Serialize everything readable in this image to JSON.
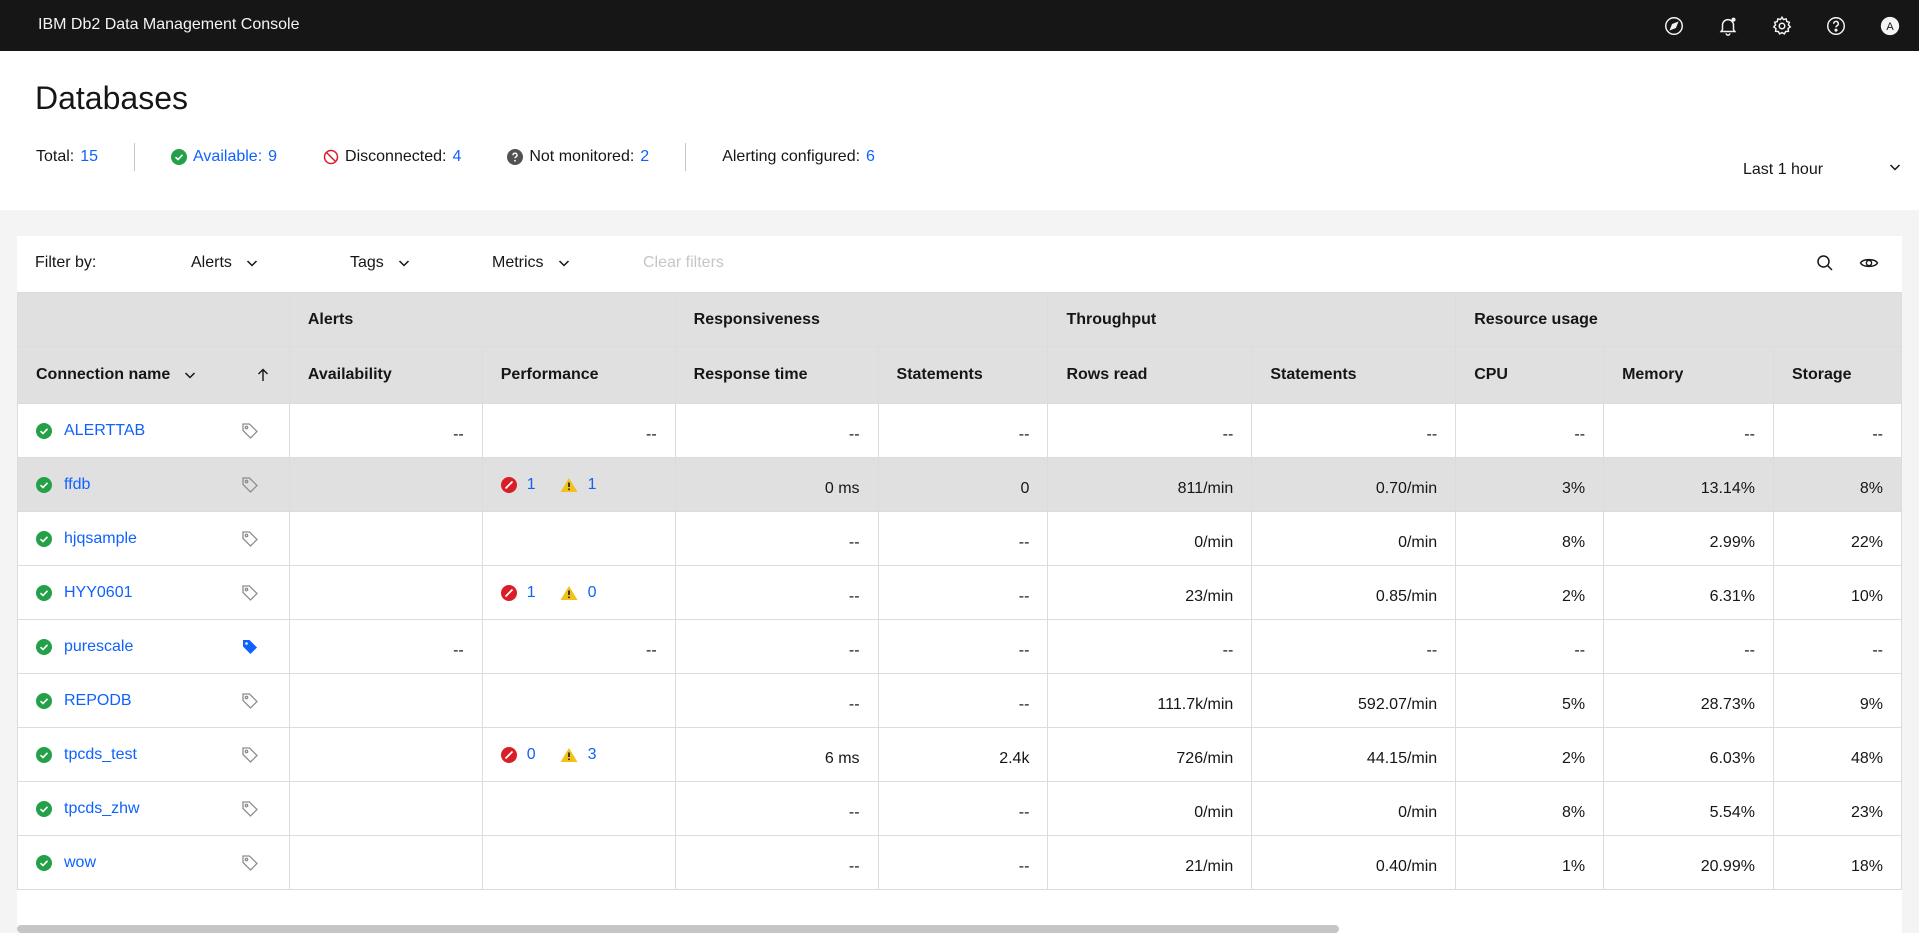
{
  "topbar": {
    "title": "IBM Db2 Data Management Console",
    "icons": [
      "compass-icon",
      "notification-icon",
      "settings-icon",
      "help-icon",
      "user-avatar"
    ],
    "avatar_letter": "A"
  },
  "header": {
    "title": "Databases",
    "total_label": "Total:",
    "total_value": "15",
    "available_label": "Available:",
    "available_value": "9",
    "disconnected_label": "Disconnected:",
    "disconnected_value": "4",
    "not_monitored_label": "Not monitored:",
    "not_monitored_value": "2",
    "alerting_label": "Alerting configured:",
    "alerting_value": "6",
    "time_range": "Last 1 hour"
  },
  "filters": {
    "label": "Filter by:",
    "alerts": "Alerts",
    "tags": "Tags",
    "metrics": "Metrics",
    "clear": "Clear filters"
  },
  "table": {
    "groups": [
      "Alerts",
      "Responsiveness",
      "Throughput",
      "Resource usage"
    ],
    "columns": {
      "connection_name": "Connection name",
      "availability": "Availability",
      "performance": "Performance",
      "response_time": "Response time",
      "resp_statements": "Statements",
      "rows_read": "Rows read",
      "thr_statements": "Statements",
      "cpu": "CPU",
      "memory": "Memory",
      "storage": "Storage"
    },
    "rows": [
      {
        "name": "ALERTTAB",
        "tag_filled": false,
        "availability": "--",
        "perf": "--",
        "perf_alerts": null,
        "response_time": "--",
        "resp_statements": "--",
        "rows_read": "--",
        "thr_statements": "--",
        "cpu": "--",
        "memory": "--",
        "storage": "--"
      },
      {
        "name": "ffdb",
        "tag_filled": false,
        "availability": "",
        "perf": "",
        "perf_alerts": {
          "critical": "1",
          "warning": "1"
        },
        "response_time": "0 ms",
        "resp_statements": "0",
        "rows_read": "811/min",
        "thr_statements": "0.70/min",
        "cpu": "3%",
        "memory": "13.14%",
        "storage": "8%",
        "selected": true
      },
      {
        "name": "hjqsample",
        "tag_filled": false,
        "availability": "",
        "perf": "",
        "perf_alerts": null,
        "response_time": "--",
        "resp_statements": "--",
        "rows_read": "0/min",
        "thr_statements": "0/min",
        "cpu": "8%",
        "memory": "2.99%",
        "storage": "22%"
      },
      {
        "name": "HYY0601",
        "tag_filled": false,
        "availability": "",
        "perf": "",
        "perf_alerts": {
          "critical": "1",
          "warning": "0"
        },
        "response_time": "--",
        "resp_statements": "--",
        "rows_read": "23/min",
        "thr_statements": "0.85/min",
        "cpu": "2%",
        "memory": "6.31%",
        "storage": "10%"
      },
      {
        "name": "purescale",
        "tag_filled": true,
        "availability": "--",
        "perf": "--",
        "perf_alerts": null,
        "response_time": "--",
        "resp_statements": "--",
        "rows_read": "--",
        "thr_statements": "--",
        "cpu": "--",
        "memory": "--",
        "storage": "--"
      },
      {
        "name": "REPODB",
        "tag_filled": false,
        "availability": "",
        "perf": "",
        "perf_alerts": null,
        "response_time": "--",
        "resp_statements": "--",
        "rows_read": "111.7k/min",
        "thr_statements": "592.07/min",
        "cpu": "5%",
        "memory": "28.73%",
        "storage": "9%"
      },
      {
        "name": "tpcds_test",
        "tag_filled": false,
        "availability": "",
        "perf": "",
        "perf_alerts": {
          "critical": "0",
          "warning": "3"
        },
        "response_time": "6 ms",
        "resp_statements": "2.4k",
        "rows_read": "726/min",
        "thr_statements": "44.15/min",
        "cpu": "2%",
        "memory": "6.03%",
        "storage": "48%"
      },
      {
        "name": "tpcds_zhw",
        "tag_filled": false,
        "availability": "",
        "perf": "",
        "perf_alerts": null,
        "response_time": "--",
        "resp_statements": "--",
        "rows_read": "0/min",
        "thr_statements": "0/min",
        "cpu": "8%",
        "memory": "5.54%",
        "storage": "23%"
      },
      {
        "name": "wow",
        "tag_filled": false,
        "availability": "",
        "perf": "",
        "perf_alerts": null,
        "response_time": "--",
        "resp_statements": "--",
        "rows_read": "21/min",
        "thr_statements": "0.40/min",
        "cpu": "1%",
        "memory": "20.99%",
        "storage": "18%"
      }
    ]
  },
  "colors": {
    "accent": "#0f62fe",
    "success": "#24a148",
    "error": "#da1e28",
    "warning": "#f1c21b",
    "topbar": "#161616"
  }
}
